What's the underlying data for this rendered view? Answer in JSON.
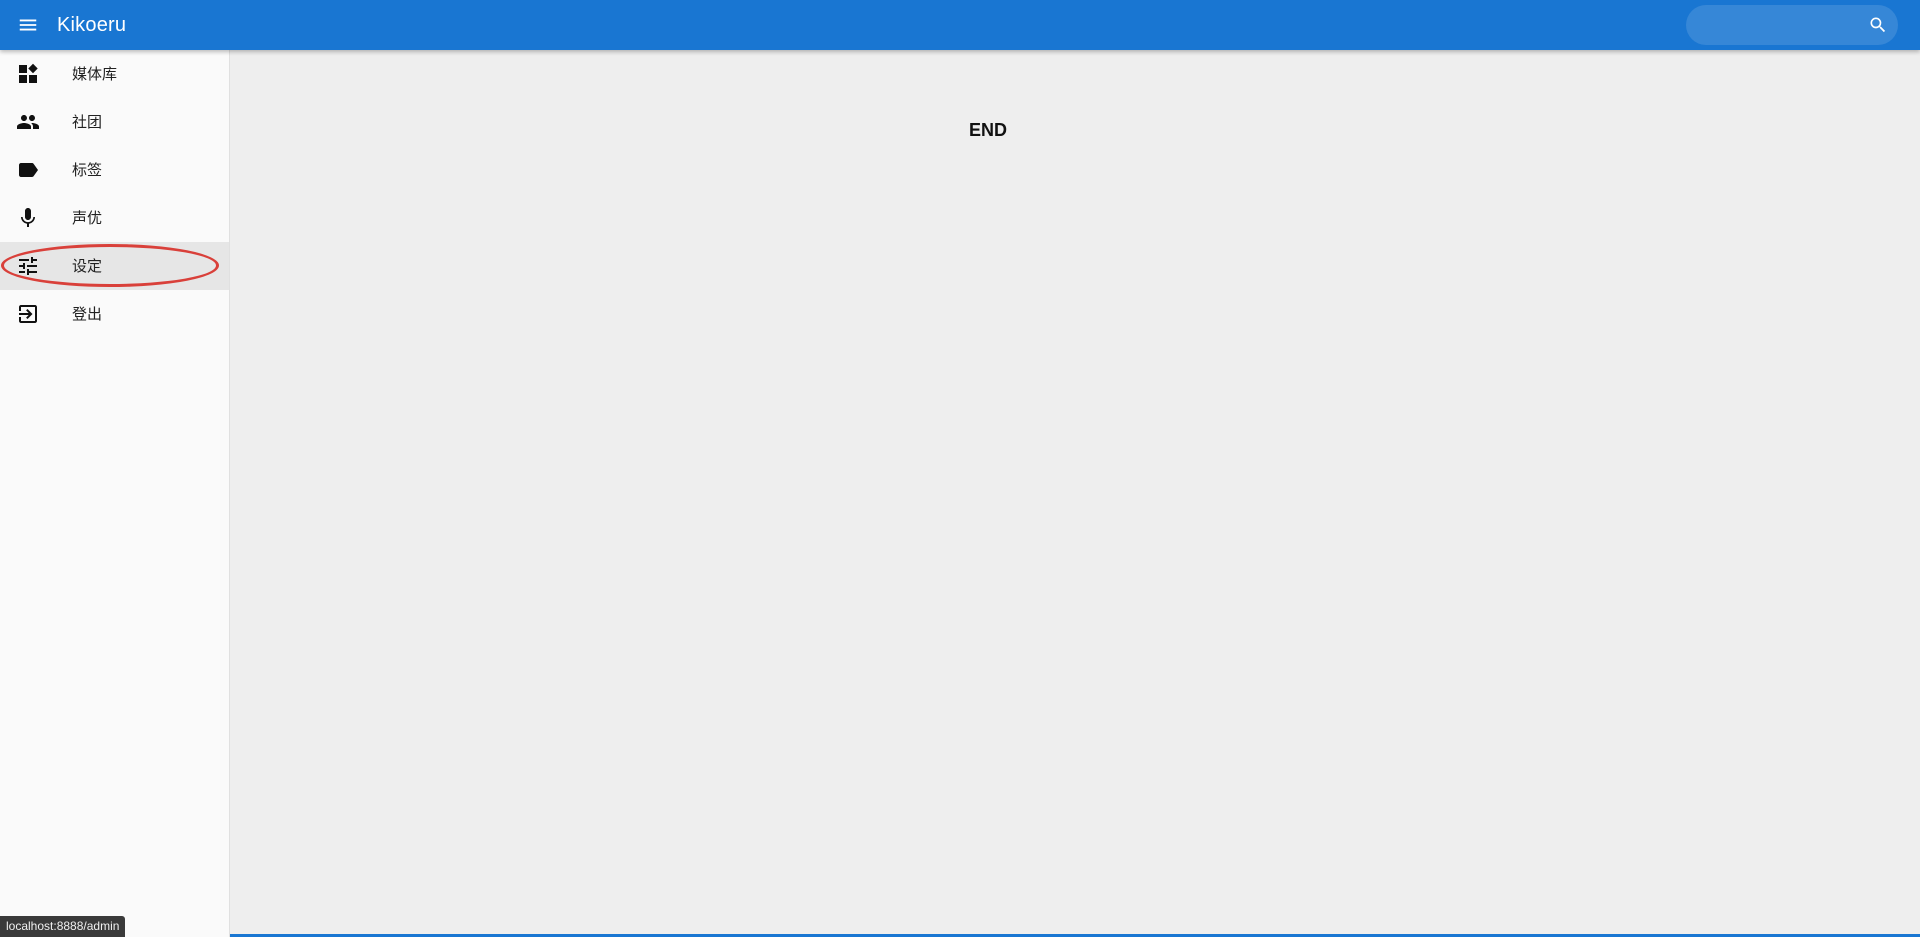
{
  "app_bar": {
    "title": "Kikoeru",
    "menu_icon": "menu-icon",
    "search": {
      "value": "",
      "placeholder": "",
      "icon": "search-icon"
    },
    "color": "#1976d2"
  },
  "sidebar": {
    "items": [
      {
        "label": "媒体库",
        "icon": "dashboard-icon"
      },
      {
        "label": "社团",
        "icon": "people-icon"
      },
      {
        "label": "标签",
        "icon": "label-icon"
      },
      {
        "label": "声优",
        "icon": "microphone-icon"
      },
      {
        "label": "设定",
        "icon": "tune-icon",
        "active": true
      },
      {
        "label": "登出",
        "icon": "logout-icon"
      }
    ]
  },
  "main": {
    "end_text": "END"
  },
  "status_bar": {
    "url": "localhost:8888/admin"
  },
  "colors": {
    "primary": "#1976d2",
    "highlight": "#d9403a",
    "sidebar_bg": "#fafafa",
    "main_bg": "#eeeeee"
  }
}
